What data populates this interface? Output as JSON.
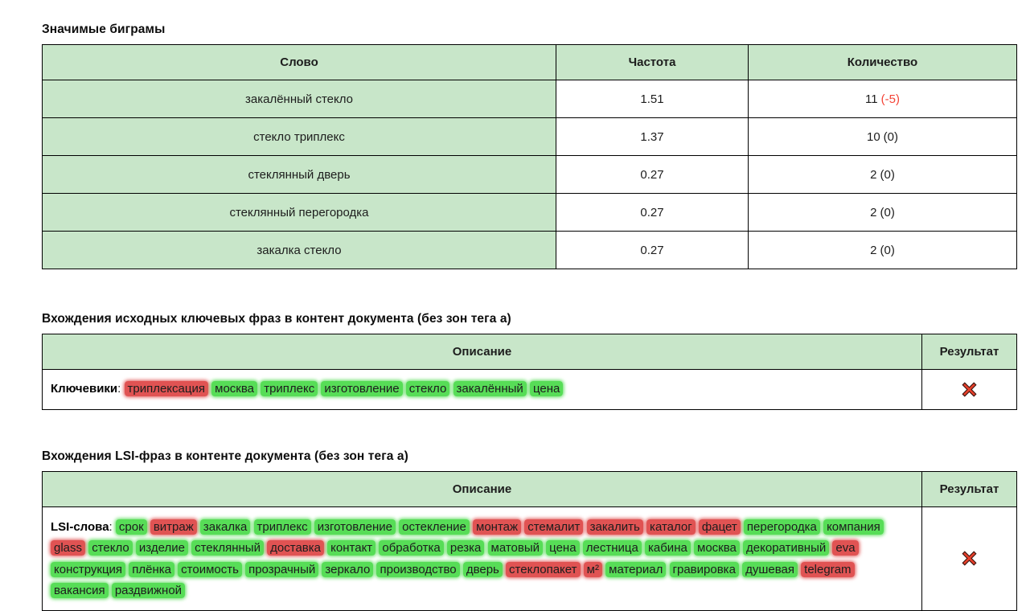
{
  "colors": {
    "table-green": "#c8e6c9",
    "hl-green": "#57dd57",
    "hl-red": "#e05353",
    "neg-red": "#f44336",
    "border": "#000000",
    "text": "#1d1d1d",
    "cross-red": "#e8402a"
  },
  "bigrams": {
    "title": "Значимые биграмы",
    "headers": [
      "Слово",
      "Частота",
      "Количество"
    ],
    "rows": [
      {
        "word": "закалённый стекло",
        "freq": "1.51",
        "count": "11",
        "delta": "(-5)"
      },
      {
        "word": "стекло триплекс",
        "freq": "1.37",
        "count": "10",
        "delta": "(0)"
      },
      {
        "word": "стеклянный дверь",
        "freq": "0.27",
        "count": "2",
        "delta": "(0)"
      },
      {
        "word": "стеклянный перегородка",
        "freq": "0.27",
        "count": "2",
        "delta": "(0)"
      },
      {
        "word": "закалка стекло",
        "freq": "0.27",
        "count": "2",
        "delta": "(0)"
      }
    ]
  },
  "keywords": {
    "title": "Вхождения исходных ключевых фраз в контент документа (без зон тега a)",
    "headers": [
      "Описание",
      "Результат"
    ],
    "label": "Ключевики",
    "separator": ": ",
    "words": [
      {
        "t": "триплексация",
        "h": "r"
      },
      {
        "t": "москва",
        "h": "g"
      },
      {
        "t": "триплекс",
        "h": "g"
      },
      {
        "t": "изготовление",
        "h": "g"
      },
      {
        "t": "стекло",
        "h": "g"
      },
      {
        "t": "закалённый",
        "h": "g"
      },
      {
        "t": "цена",
        "h": "g"
      }
    ],
    "result_icon": "red-cross"
  },
  "lsi": {
    "title": "Вхождения LSI-фраз в контенте документа (без зон тега a)",
    "headers": [
      "Описание",
      "Результат"
    ],
    "label": "LSI-слова",
    "separator": ": ",
    "words": [
      {
        "t": "срок",
        "h": "g"
      },
      {
        "t": "витраж",
        "h": "r"
      },
      {
        "t": "закалка",
        "h": "g"
      },
      {
        "t": "триплекс",
        "h": "g"
      },
      {
        "t": "изготовление",
        "h": "g"
      },
      {
        "t": "остекление",
        "h": "g"
      },
      {
        "t": "монтаж",
        "h": "r"
      },
      {
        "t": "стемалит",
        "h": "r"
      },
      {
        "t": "закалить",
        "h": "r"
      },
      {
        "t": "каталог",
        "h": "r"
      },
      {
        "t": "фацет",
        "h": "r"
      },
      {
        "t": "перегородка",
        "h": "g"
      },
      {
        "t": "компания",
        "h": "g"
      },
      {
        "t": "glass",
        "h": "r"
      },
      {
        "t": "стекло",
        "h": "g"
      },
      {
        "t": "изделие",
        "h": "g"
      },
      {
        "t": "стеклянный",
        "h": "g"
      },
      {
        "t": "доставка",
        "h": "r"
      },
      {
        "t": "контакт",
        "h": "g"
      },
      {
        "t": "обработка",
        "h": "g"
      },
      {
        "t": "резка",
        "h": "g"
      },
      {
        "t": "матовый",
        "h": "g"
      },
      {
        "t": "цена",
        "h": "g"
      },
      {
        "t": "лестница",
        "h": "g"
      },
      {
        "t": "кабина",
        "h": "g"
      },
      {
        "t": "москва",
        "h": "g"
      },
      {
        "t": "декоративный",
        "h": "g"
      },
      {
        "t": "eva",
        "h": "r"
      },
      {
        "t": "конструкция",
        "h": "g"
      },
      {
        "t": "плёнка",
        "h": "g"
      },
      {
        "t": "стоимость",
        "h": "g"
      },
      {
        "t": "прозрачный",
        "h": "g"
      },
      {
        "t": "зеркало",
        "h": "g"
      },
      {
        "t": "производство",
        "h": "g"
      },
      {
        "t": "дверь",
        "h": "g"
      },
      {
        "t": "стеклопакет",
        "h": "r"
      },
      {
        "t": "м²",
        "h": "r"
      },
      {
        "t": "материал",
        "h": "g"
      },
      {
        "t": "гравировка",
        "h": "g"
      },
      {
        "t": "душевая",
        "h": "g"
      },
      {
        "t": "telegram",
        "h": "r"
      },
      {
        "t": "вакансия",
        "h": "g"
      },
      {
        "t": "раздвижной",
        "h": "g"
      }
    ],
    "result_icon": "red-cross"
  }
}
